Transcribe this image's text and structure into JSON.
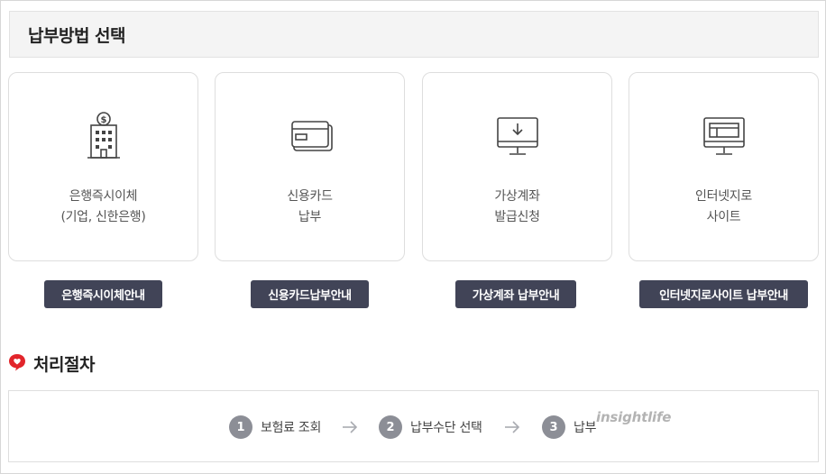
{
  "header": {
    "title": "납부방법 선택"
  },
  "methods": [
    {
      "icon": "bank-building-icon",
      "label_line1": "은행즉시이체",
      "label_line2": "(기업, 신한은행)",
      "button": "은행즉시이체안내"
    },
    {
      "icon": "credit-card-icon",
      "label_line1": "신용카드",
      "label_line2": "납부",
      "button": "신용카드납부안내"
    },
    {
      "icon": "monitor-download-icon",
      "label_line1": "가상계좌",
      "label_line2": "발급신청",
      "button": "가상계좌 납부안내"
    },
    {
      "icon": "monitor-web-icon",
      "label_line1": "인터넷지로",
      "label_line2": "사이트",
      "button": "인터넷지로사이트 납부안내"
    }
  ],
  "procedure": {
    "title": "처리절차",
    "steps": [
      {
        "num": "1",
        "label": "보험료 조회"
      },
      {
        "num": "2",
        "label": "납부수단 선택"
      },
      {
        "num": "3",
        "label": "납부"
      }
    ]
  },
  "watermark": "insightlife",
  "colors": {
    "button_bg": "#414457",
    "step_circle": "#8c8e96",
    "accent_red": "#e2252b"
  }
}
